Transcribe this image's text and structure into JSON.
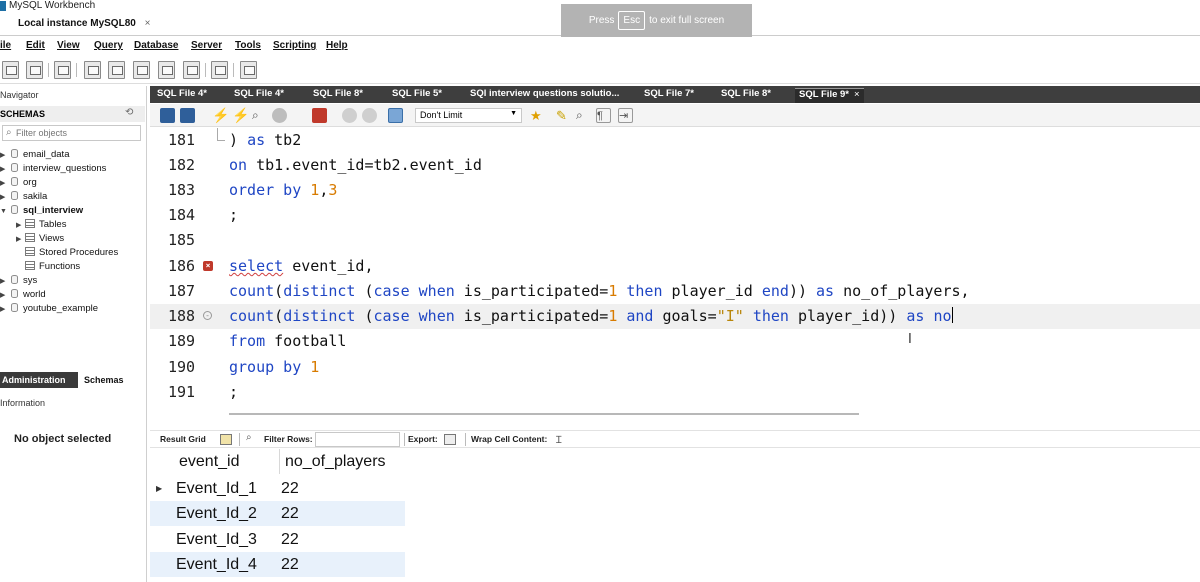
{
  "window": {
    "title": "MySQL Workbench"
  },
  "connection_tab": {
    "label": "Local instance MySQL80",
    "close": "×"
  },
  "fullscreen_notice": {
    "before": "Press",
    "key": "Esc",
    "after": "to exit full screen"
  },
  "menu": [
    "File",
    "Edit",
    "View",
    "Query",
    "Database",
    "Server",
    "Tools",
    "Scripting",
    "Help"
  ],
  "menu_visible_text": [
    "ile",
    "Edit",
    "View",
    "Query",
    "Database",
    "Server",
    "Tools",
    "Scripting",
    "Help"
  ],
  "sidebar": {
    "navigator_label": "Navigator",
    "schemas_label": "SCHEMAS",
    "refresh_icon": "refresh-icon",
    "filter_placeholder": "Filter objects",
    "schemas": [
      {
        "name": "email_data",
        "expanded": false
      },
      {
        "name": "interview_questions",
        "expanded": false
      },
      {
        "name": "org",
        "expanded": false
      },
      {
        "name": "sakila",
        "expanded": false
      },
      {
        "name": "sql_interview",
        "expanded": true,
        "bold": true
      },
      {
        "name": "sys",
        "expanded": false
      },
      {
        "name": "world",
        "expanded": false
      },
      {
        "name": "youtube_example",
        "expanded": false
      }
    ],
    "sql_interview_children": [
      "Tables",
      "Views",
      "Stored Procedures",
      "Functions"
    ],
    "tabs": {
      "administration": "Administration",
      "schemas": "Schemas"
    },
    "info_label": "Information",
    "no_object": "No object selected"
  },
  "file_tabs": [
    {
      "label": "SQL File 4*"
    },
    {
      "label": "SQL File 4*"
    },
    {
      "label": "SQL File 8*"
    },
    {
      "label": "SQL File 5*"
    },
    {
      "label": "SQl interview questions solutio..."
    },
    {
      "label": "SQL File 7*"
    },
    {
      "label": "SQL File 8*"
    },
    {
      "label": "SQL File 9*",
      "active": true,
      "close": "×"
    }
  ],
  "editor_toolbar": {
    "limit": "Don't Limit"
  },
  "editor": {
    "lines": [
      {
        "num": "181",
        "text": ") as tb2"
      },
      {
        "num": "182",
        "text": "on tb1.event_id=tb2.event_id"
      },
      {
        "num": "183",
        "text": "order by 1,3"
      },
      {
        "num": "184",
        "text": ";"
      },
      {
        "num": "185",
        "text": ""
      },
      {
        "num": "186",
        "text": "select event_id,"
      },
      {
        "num": "187",
        "text": "count(distinct (case when is_participated=1 then player_id end)) as no_of_players,"
      },
      {
        "num": "188",
        "text": "count(distinct (case when is_participated=1 and goals=\"I\" then player_id)) as no"
      },
      {
        "num": "189",
        "text": "from football"
      },
      {
        "num": "190",
        "text": "group by 1"
      },
      {
        "num": "191",
        "text": ";"
      }
    ]
  },
  "result_toolbar": {
    "result_grid": "Result Grid",
    "filter_rows": "Filter Rows:",
    "export": "Export:",
    "wrap_cell": "Wrap Cell Content:"
  },
  "result_grid": {
    "columns": [
      "event_id",
      "no_of_players"
    ],
    "rows": [
      [
        "Event_Id_1",
        "22"
      ],
      [
        "Event_Id_2",
        "22"
      ],
      [
        "Event_Id_3",
        "22"
      ],
      [
        "Event_Id_4",
        "22"
      ]
    ]
  }
}
